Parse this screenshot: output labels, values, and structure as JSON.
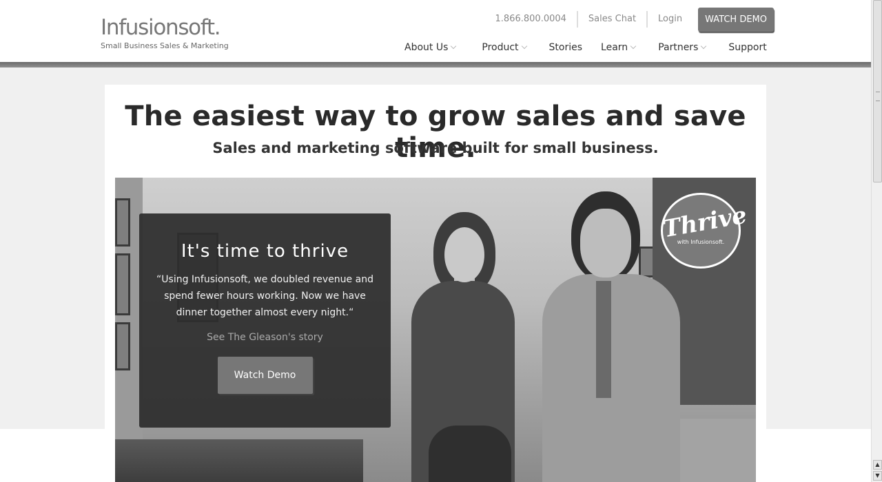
{
  "logo": {
    "name": "Infusionsoft.",
    "tagline": "Small Business Sales & Marketing"
  },
  "topbar": {
    "phone": "1.866.800.0004",
    "sales_chat": "Sales Chat",
    "login": "Login",
    "watch_demo": "WATCH DEMO"
  },
  "nav": {
    "items": [
      {
        "label": "About Us",
        "dropdown": true
      },
      {
        "label": "Product",
        "dropdown": true
      },
      {
        "label": "Stories",
        "dropdown": false
      },
      {
        "label": "Learn",
        "dropdown": true
      },
      {
        "label": "Partners",
        "dropdown": true
      },
      {
        "label": "Support",
        "dropdown": false
      }
    ]
  },
  "hero": {
    "headline": "The easiest way to grow sales and save time.",
    "subhead": "Sales and marketing software built for small business.",
    "badge": {
      "word": "Thrive",
      "sub": "with Infusionsoft."
    }
  },
  "overlay": {
    "title": "It's time to thrive",
    "quote": "“Using Infusionsoft, we doubled revenue and spend fewer hours working. Now we have dinner together almost every night.“",
    "story_link": "See The Gleason's story",
    "button": "Watch Demo"
  },
  "colors": {
    "header_bg": "#ffffff",
    "page_bg": "#f0f0f0",
    "button_gray": "#777777",
    "overlay_bg": "#2d2d2d"
  }
}
